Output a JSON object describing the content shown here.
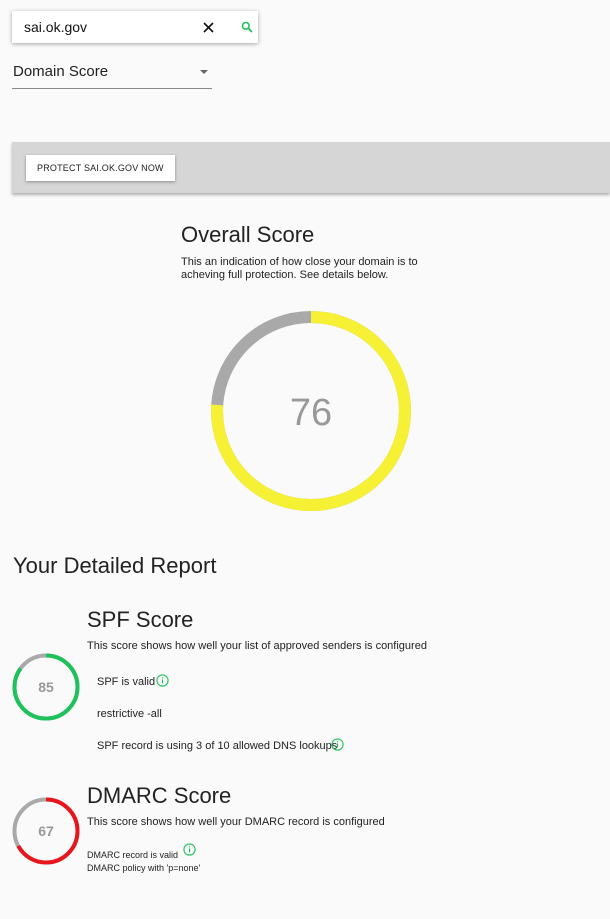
{
  "search": {
    "value": "sai.ok.gov"
  },
  "domain_select": {
    "selected": "Domain Score"
  },
  "banner": {
    "protect_button": "PROTECT SAI.OK.GOV NOW"
  },
  "overall": {
    "title": "Overall Score",
    "description": "This an indication of how close your domain is to acheving full protection. See details below.",
    "score": 76,
    "score_text": "76",
    "color": "#f7f136",
    "track_color": "#a9a9a9"
  },
  "report": {
    "title": "Your Detailed Report",
    "spf": {
      "title": "SPF Score",
      "description": "This score shows how well your list of approved senders is configured",
      "score": 85,
      "score_text": "85",
      "color": "#1ec25b",
      "checks": [
        "SPF is valid",
        "restrictive -all",
        "SPF record is using 3 of 10 allowed DNS lookups"
      ]
    },
    "dmarc": {
      "title": "DMARC Score",
      "description": "This score shows how well your DMARC record is configured",
      "score": 67,
      "score_text": "67",
      "color": "#e8161c",
      "checks": [
        "DMARC record is valid",
        "DMARC policy with 'p=none'"
      ]
    }
  },
  "colors": {
    "accent_green": "#1ec25b",
    "track_grey": "#a9a9a9"
  }
}
